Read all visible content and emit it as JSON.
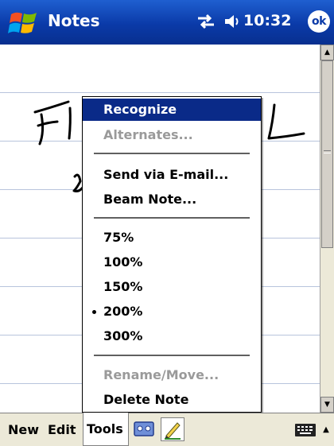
{
  "title_bar": {
    "app_title": "Notes",
    "clock": "10:32",
    "ok_label": "ok",
    "start_icon": "windows-flag-icon",
    "connectivity_icon": "connectivity-icon",
    "volume_icon": "speaker-icon"
  },
  "tools_menu": {
    "items": [
      {
        "label": "Recognize",
        "state": "selected"
      },
      {
        "label": "Alternates...",
        "state": "disabled"
      },
      {
        "label": "Send via E-mail...",
        "state": "enabled"
      },
      {
        "label": "Beam Note...",
        "state": "enabled"
      },
      {
        "label": "75%",
        "state": "enabled"
      },
      {
        "label": "100%",
        "state": "enabled"
      },
      {
        "label": "150%",
        "state": "enabled"
      },
      {
        "label": "200%",
        "state": "checked"
      },
      {
        "label": "300%",
        "state": "enabled"
      },
      {
        "label": "Rename/Move...",
        "state": "disabled"
      },
      {
        "label": "Delete Note",
        "state": "enabled"
      }
    ]
  },
  "command_bar": {
    "new_label": "New",
    "edit_label": "Edit",
    "tools_label": "Tools",
    "recorder_icon": "cassette-recorder-icon",
    "pen_icon": "pen-icon",
    "keyboard_icon": "keyboard-icon"
  },
  "colors": {
    "title_bar": "#0a3aa8",
    "menu_highlight": "#0a2a88",
    "disabled_text": "#9a9a9a",
    "note_rule": "#b8c4dc",
    "bar_background": "#ece9d8"
  }
}
